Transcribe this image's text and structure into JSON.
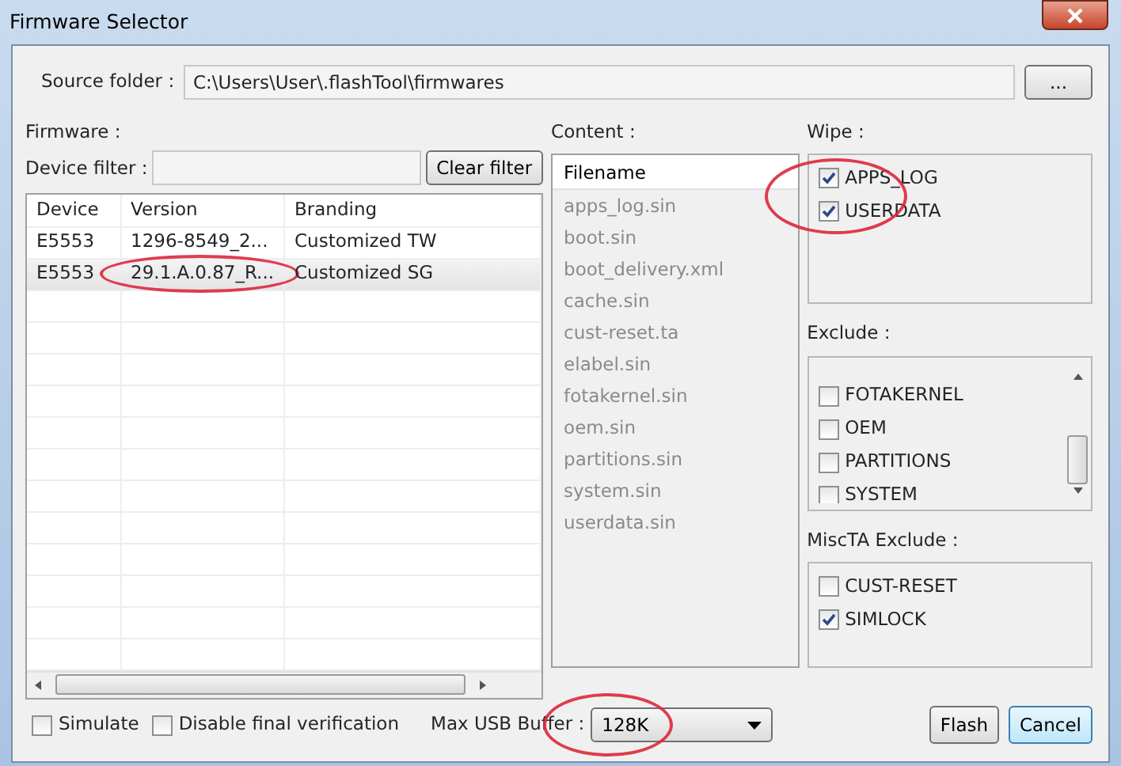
{
  "window": {
    "title": "Firmware Selector"
  },
  "source_folder": {
    "label": "Source folder :",
    "value": "C:\\Users\\User\\.flashTool\\firmwares",
    "browse_button": "..."
  },
  "firmware": {
    "label": "Firmware :",
    "filter_label": "Device filter :",
    "clear_button": "Clear filter",
    "columns": [
      "Device",
      "Version",
      "Branding"
    ],
    "rows": [
      {
        "cells": [
          "E5553",
          "1296-8549_2...",
          "Customized TW"
        ],
        "selected": false,
        "annotated": false
      },
      {
        "cells": [
          "E5553",
          "29.1.A.0.87_R...",
          "Customized SG"
        ],
        "selected": true,
        "annotated": true
      }
    ]
  },
  "content": {
    "label": "Content :",
    "column": "Filename",
    "files": [
      "apps_log.sin",
      "boot.sin",
      "boot_delivery.xml",
      "cache.sin",
      "cust-reset.ta",
      "elabel.sin",
      "fotakernel.sin",
      "oem.sin",
      "partitions.sin",
      "system.sin",
      "userdata.sin"
    ]
  },
  "wipe": {
    "label": "Wipe :",
    "annotated": true,
    "items": [
      {
        "label": "APPS_LOG",
        "checked": true
      },
      {
        "label": "USERDATA",
        "checked": true
      }
    ]
  },
  "exclude": {
    "label": "Exclude :",
    "items": [
      {
        "label": "FOTAKERNEL",
        "checked": false
      },
      {
        "label": "OEM",
        "checked": false
      },
      {
        "label": "PARTITIONS",
        "checked": false
      },
      {
        "label": "SYSTEM",
        "checked": false
      }
    ]
  },
  "miscta_exclude": {
    "label": "MiscTA Exclude :",
    "items": [
      {
        "label": "CUST-RESET",
        "checked": false
      },
      {
        "label": "SIMLOCK",
        "checked": true
      }
    ]
  },
  "options": [
    {
      "label": "Simulate",
      "checked": false
    },
    {
      "label": "Disable final verification",
      "checked": false
    }
  ],
  "usb_buffer": {
    "label": "Max USB Buffer :",
    "value": "128K",
    "annotated": true
  },
  "buttons": [
    {
      "label": "Flash",
      "kind": "plain"
    },
    {
      "label": "Cancel",
      "kind": "default"
    }
  ]
}
